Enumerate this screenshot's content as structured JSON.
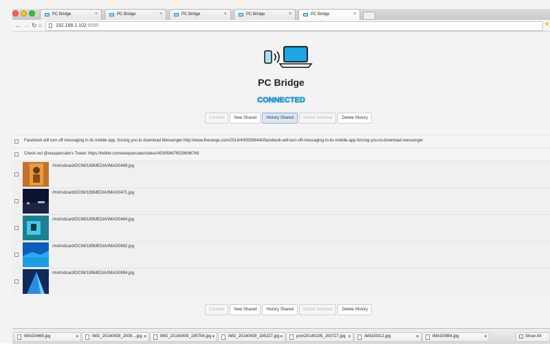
{
  "browser": {
    "tabs": [
      {
        "title": "PC Bridge"
      },
      {
        "title": "PC Bridge"
      },
      {
        "title": "PC Bridge"
      },
      {
        "title": "PC Bridge"
      },
      {
        "title": "PC Bridge"
      }
    ],
    "active_tab": 4,
    "url_host": "192.168.1.102",
    "url_port": ":8585",
    "nav_icons": [
      "back-arrow-icon",
      "forward-arrow-icon",
      "reload-icon",
      "home-icon"
    ],
    "star_icon": "star-icon",
    "traffic_colors": [
      "#ff5f57",
      "#febc2e",
      "#28c840"
    ]
  },
  "app": {
    "title": "PC Bridge",
    "status": "CONNECTED",
    "status_color": "#1aa6e8",
    "logo_icon": "phone-to-laptop-icon",
    "buttons": {
      "connect": "Connect",
      "new_shared": "New Shared",
      "history_shared": "History Shared",
      "delete_selected": "Delete Selected",
      "delete_history": "Delete History"
    }
  },
  "items": [
    {
      "type": "text",
      "text": "Facebook will turn off messaging in its mobile app, forcing you to download Messenger http://www.theverge.com/2014/4/9/5598440/facebook-will-turn-off-messaging-in-its-mobile-app-forcing-you-to-download-messenger"
    },
    {
      "type": "text",
      "text": "Check out @waxpancake's Tweet: https://twitter.com/waxpancake/status/453958676529696769"
    },
    {
      "type": "image",
      "path": "/mnt/sdcard/DCIM/185MEDIA/IMAG0469.jpg",
      "thumb": "orange-figure"
    },
    {
      "type": "image",
      "path": "/mnt/sdcard/DCIM/185MEDIA/IMAG0471.jpg",
      "thumb": "night-sky"
    },
    {
      "type": "image",
      "path": "/mnt/sdcard/DCIM/185MEDIA/IMAG0484.jpg",
      "thumb": "cyan-device"
    },
    {
      "type": "image",
      "path": "/mnt/sdcard/DCIM/185MEDIA/IMAG0882.jpg",
      "thumb": "blue-landscape"
    },
    {
      "type": "image",
      "path": "/mnt/sdcard/DCIM/185MEDIA/IMAG0884.jpg",
      "thumb": "blue-building"
    }
  ],
  "downloads": {
    "items": [
      {
        "name": "IMAG0469.jpg"
      },
      {
        "name": "IMG_20140409_2009....jpg"
      },
      {
        "name": "IMG_20140409_195704.jpg"
      },
      {
        "name": "IMG_20140409_195227.jpg"
      },
      {
        "name": "pom20140105_200727.jpg"
      },
      {
        "name": "IMAG0012.jpg"
      },
      {
        "name": "IMAG0884.jpg"
      }
    ],
    "show_all": "Show All"
  }
}
